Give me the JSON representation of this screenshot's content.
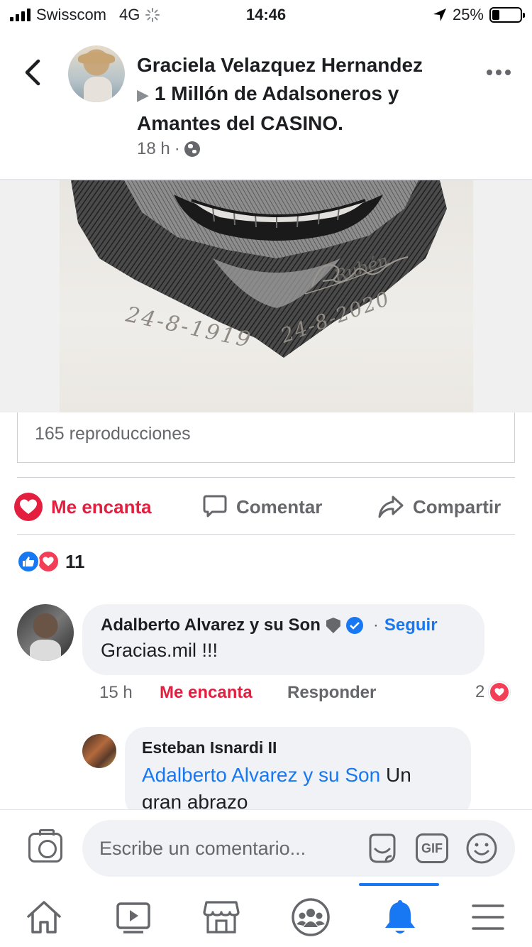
{
  "status_bar": {
    "carrier": "Swisscom",
    "network": "4G",
    "time": "14:46",
    "battery": "25%",
    "battery_level": 0.25
  },
  "post": {
    "author": "Graciela Velazquez Hernandez",
    "group": "1 Millón de Adalsoneros y Amantes del CASINO.",
    "time": "18 h",
    "separator": "·",
    "views": "165 reproducciones"
  },
  "artwork": {
    "signature": "Rubén",
    "date_left": "24-8-1919",
    "date_right": "24-8-2020"
  },
  "actions": {
    "love": "Me encanta",
    "comment": "Comentar",
    "share": "Compartir"
  },
  "reactions": {
    "count": "11"
  },
  "comments": [
    {
      "author": "Adalberto Alvarez y su Son",
      "separator": "·",
      "follow": "Seguir",
      "text": "Gracias.mil !!!",
      "time": "15 h",
      "love": "Me encanta",
      "reply": "Responder",
      "reaction_count": "2"
    }
  ],
  "reply": {
    "author": "Esteban Isnardi II",
    "mention": "Adalberto Alvarez y su Son",
    "text": " Un gran abrazo"
  },
  "composer": {
    "placeholder": "Escribe un comentario...",
    "gif": "GIF"
  },
  "colors": {
    "accent": "#1877f2",
    "love": "#e41e3f",
    "secondary_text": "#65676b"
  }
}
